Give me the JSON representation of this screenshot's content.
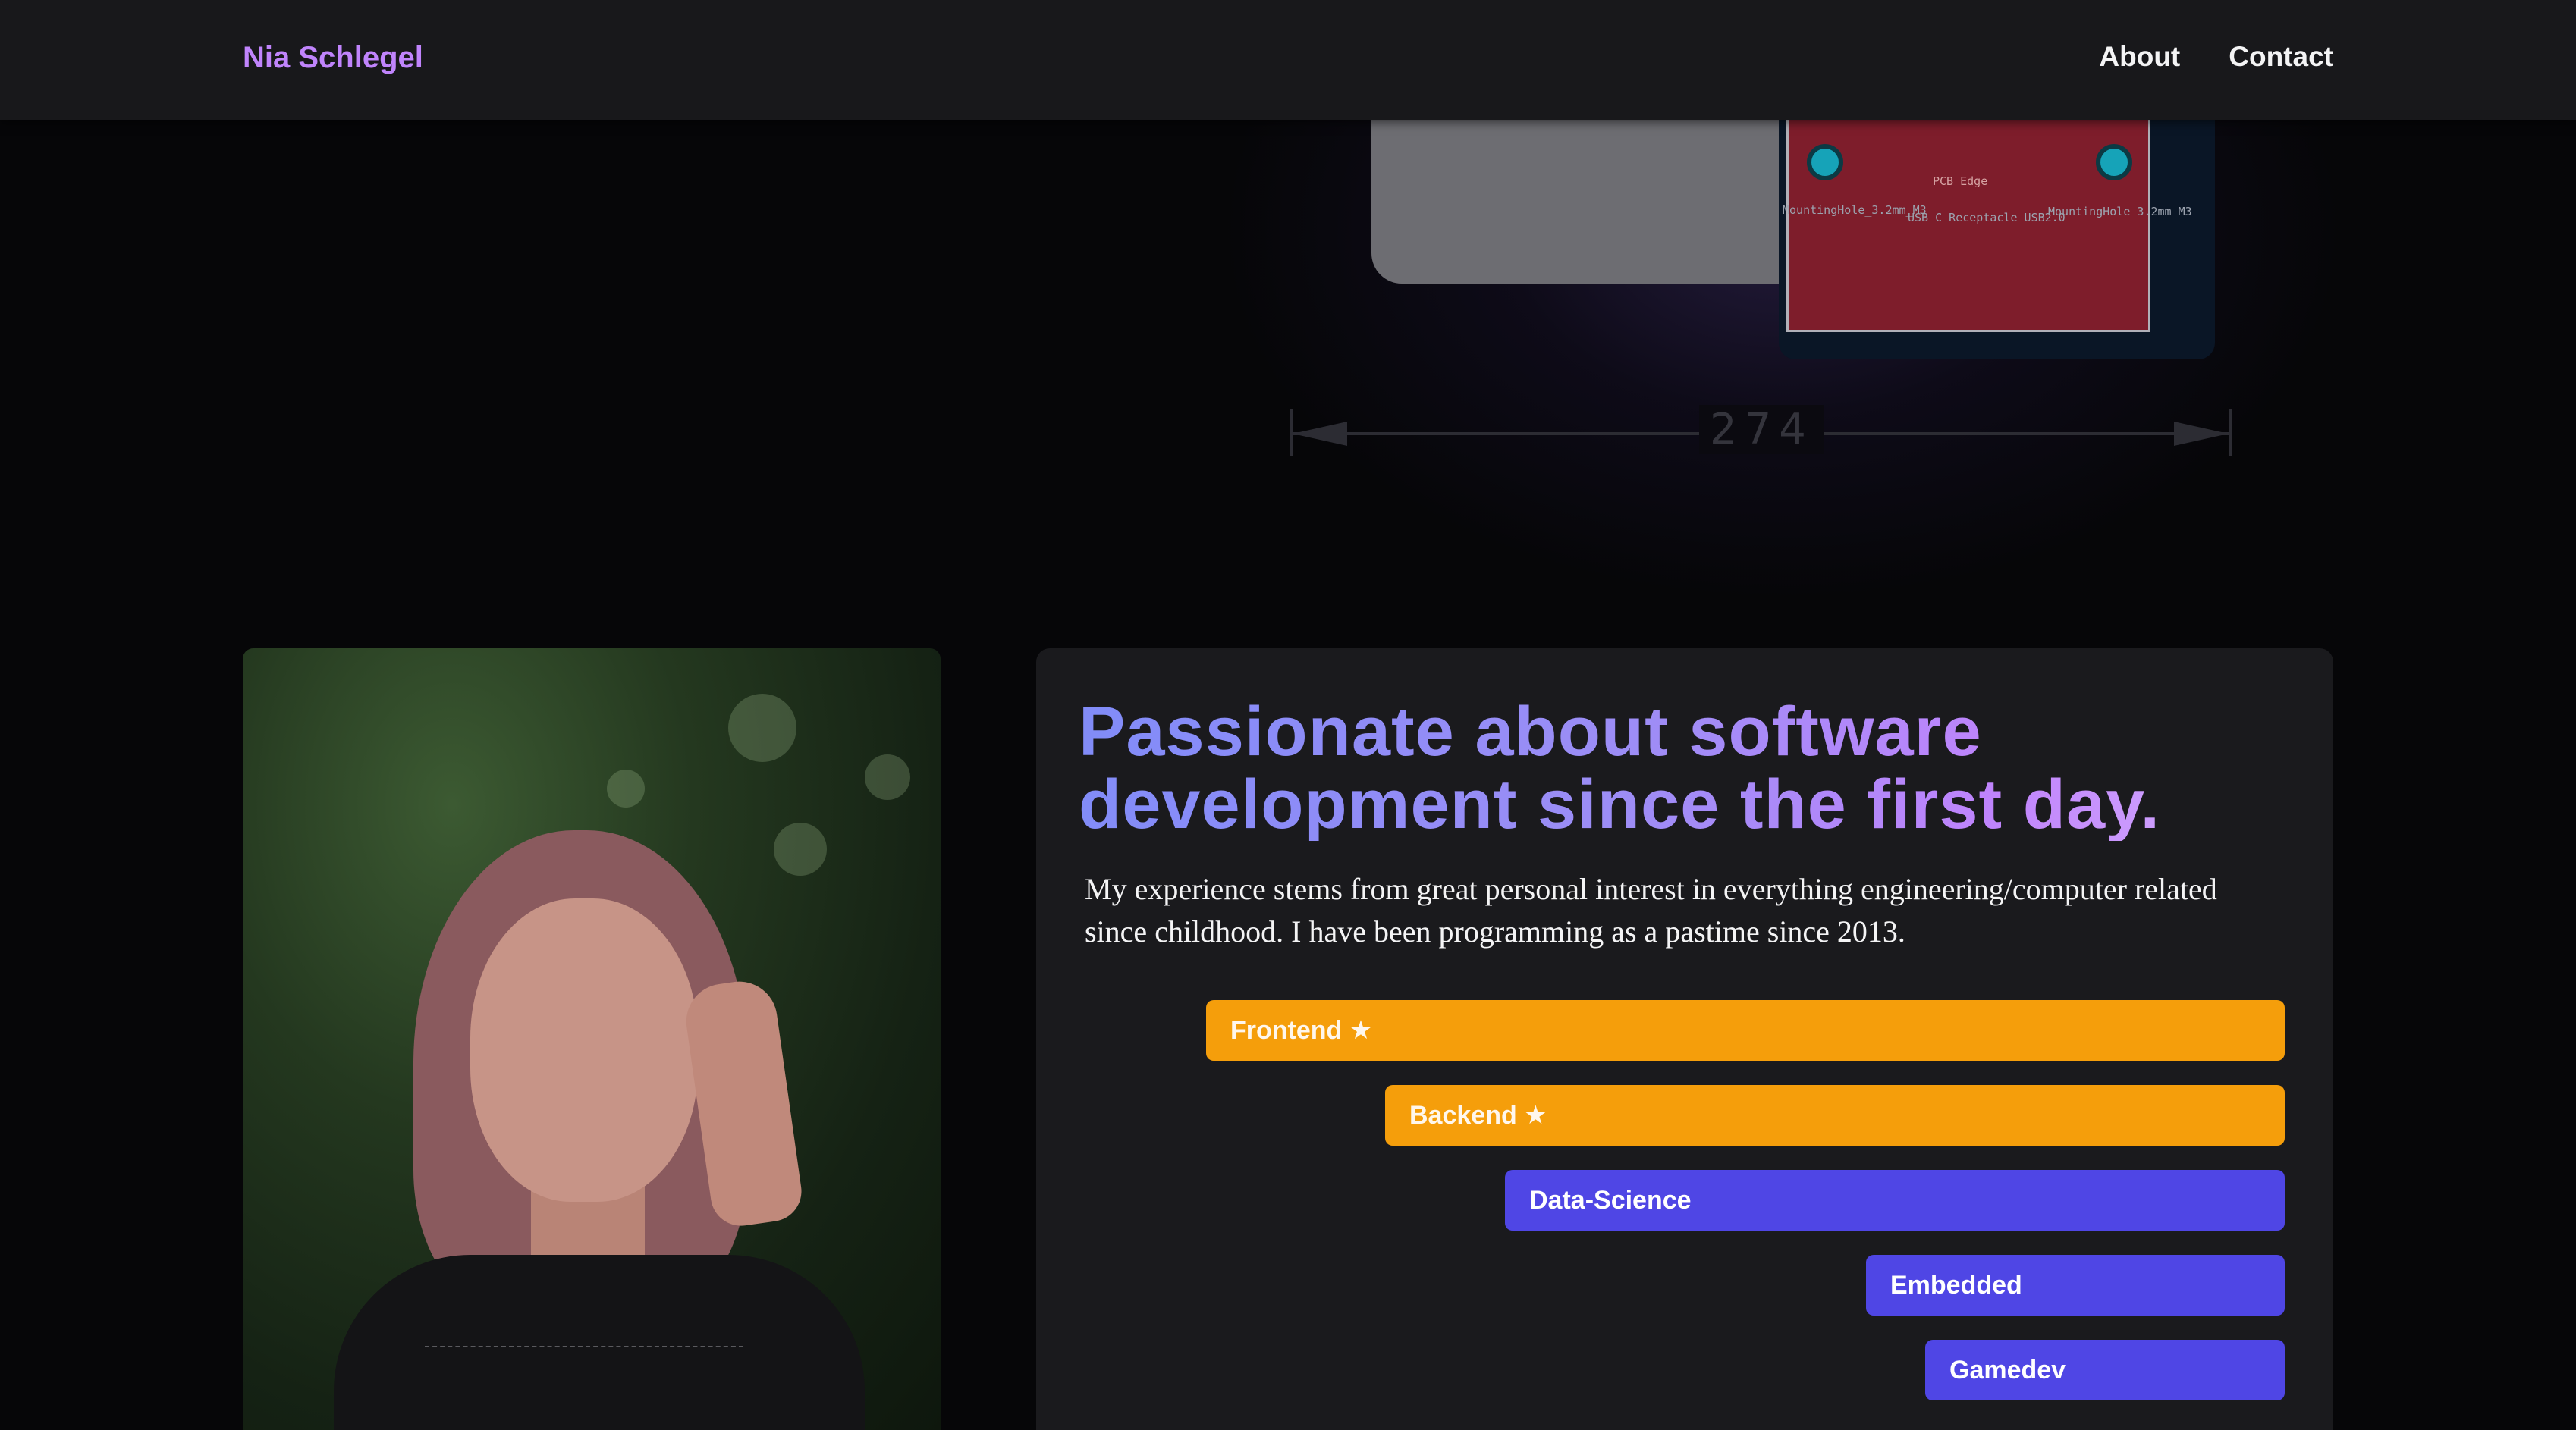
{
  "header": {
    "brand": "Nia Schlegel",
    "nav": [
      {
        "label": "About"
      },
      {
        "label": "Contact"
      }
    ]
  },
  "hero": {
    "dimension_label": "274",
    "pcb_labels": {
      "left_hole": "MountingHole_3.2mm_M3",
      "right_hole": "MountingHole_3.2mm_M3",
      "connector": "USB_C_Receptacle_USB2.0",
      "edge": "PCB Edge"
    }
  },
  "about": {
    "photo_alt": "Portrait photo",
    "headline": "Passionate about software development since the first day.",
    "intro": "My experience stems from great personal interest in everything engineering/computer related since childhood. I have been programming as a pastime since 2013.",
    "skills": [
      {
        "label": "Frontend ★",
        "favorite": true,
        "level": 1.0
      },
      {
        "label": "Backend ★",
        "favorite": true,
        "level": 0.834
      },
      {
        "label": "Data-Science",
        "favorite": false,
        "level": 0.723
      },
      {
        "label": "Embedded",
        "favorite": false,
        "level": 0.388
      },
      {
        "label": "Gamedev",
        "favorite": false,
        "level": 0.333
      }
    ]
  },
  "colors": {
    "accent_purple": "#c084fc",
    "favorite_bar": "#f59e0b",
    "skill_bar": "#4f46e5",
    "card_bg": "#1a1a1d",
    "header_bg": "#18181b"
  }
}
